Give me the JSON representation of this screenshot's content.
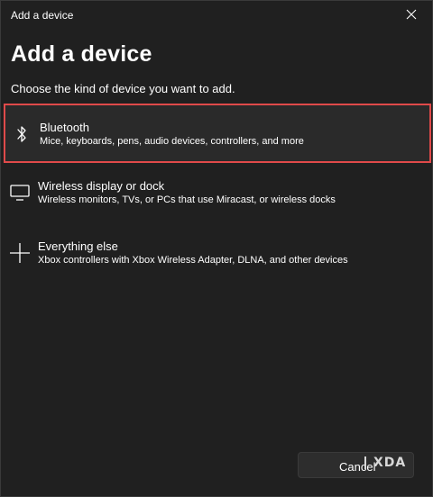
{
  "window": {
    "title": "Add a device"
  },
  "main": {
    "heading": "Add a device",
    "subtitle": "Choose the kind of device you want to add."
  },
  "options": [
    {
      "icon": "bluetooth-icon",
      "title": "Bluetooth",
      "description": "Mice, keyboards, pens, audio devices, controllers, and more",
      "selected": true
    },
    {
      "icon": "monitor-icon",
      "title": "Wireless display or dock",
      "description": "Wireless monitors, TVs, or PCs that use Miracast, or wireless docks",
      "selected": false
    },
    {
      "icon": "plus-icon",
      "title": "Everything else",
      "description": "Xbox controllers with Xbox Wireless Adapter, DLNA, and other devices",
      "selected": false
    }
  ],
  "footer": {
    "cancel_label": "Cancel"
  },
  "watermark": {
    "text": "XDA"
  },
  "colors": {
    "background": "#202020",
    "selection_border": "#e04a4a",
    "text": "#ffffff"
  }
}
